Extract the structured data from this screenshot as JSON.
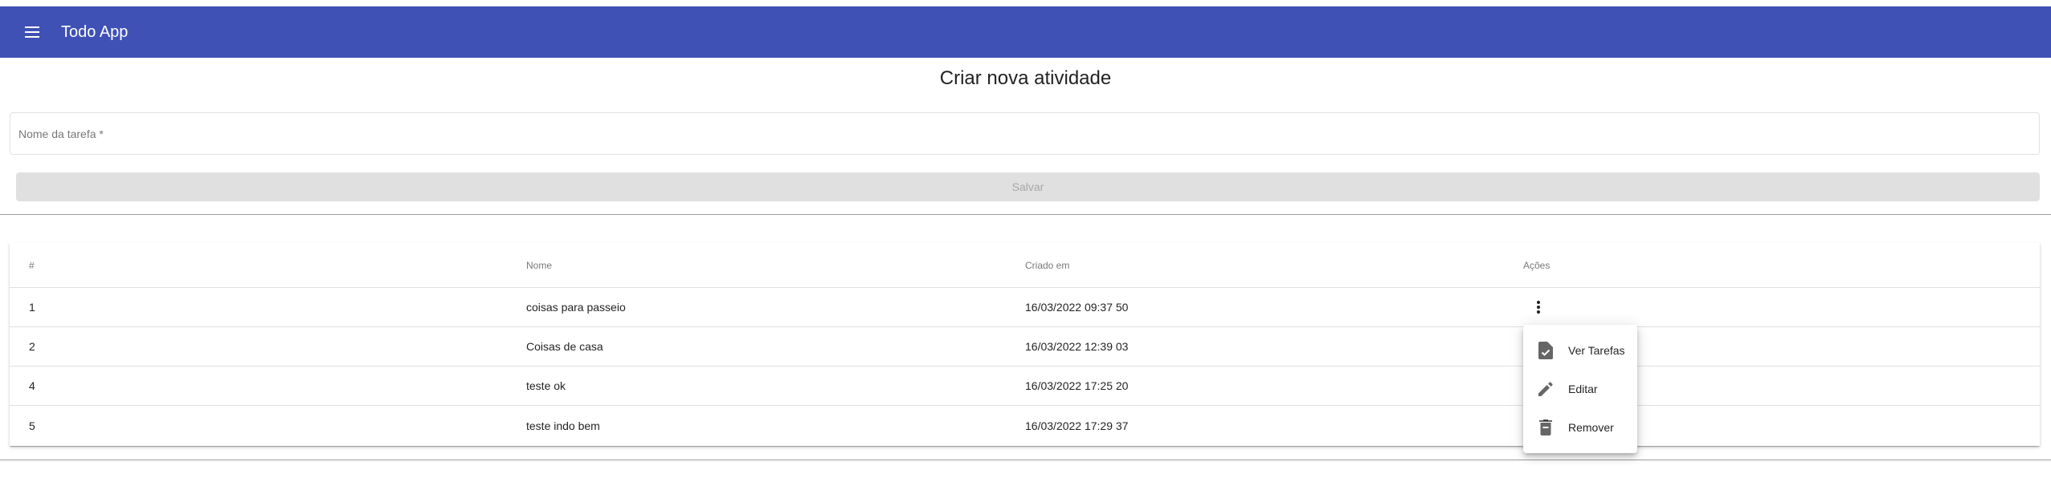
{
  "toolbar": {
    "menu_icon": "menu-icon",
    "title": "Todo App",
    "background": "#3f51b5"
  },
  "form": {
    "heading": "Criar nova atividade",
    "task_name": {
      "placeholder": "Nome da tarefa *",
      "value": ""
    },
    "save_label": "Salvar"
  },
  "table": {
    "headers": {
      "id": "#",
      "name": "Nome",
      "created": "Criado em",
      "actions": "Ações"
    },
    "rows": [
      {
        "id": "1",
        "name": "coisas para passeio",
        "created": "16/03/2022 09:37 50"
      },
      {
        "id": "2",
        "name": "Coisas de casa",
        "created": "16/03/2022 12:39 03"
      },
      {
        "id": "4",
        "name": "teste ok",
        "created": "16/03/2022 17:25 20"
      },
      {
        "id": "5",
        "name": "teste indo bem",
        "created": "16/03/2022 17:29 37"
      }
    ],
    "row_action_icon": "more-vert-icon"
  },
  "context_menu": {
    "items": [
      {
        "label": "Ver Tarefas",
        "icon": "task-check-icon"
      },
      {
        "label": "Editar",
        "icon": "edit-icon"
      },
      {
        "label": "Remover",
        "icon": "delete-icon"
      }
    ]
  }
}
